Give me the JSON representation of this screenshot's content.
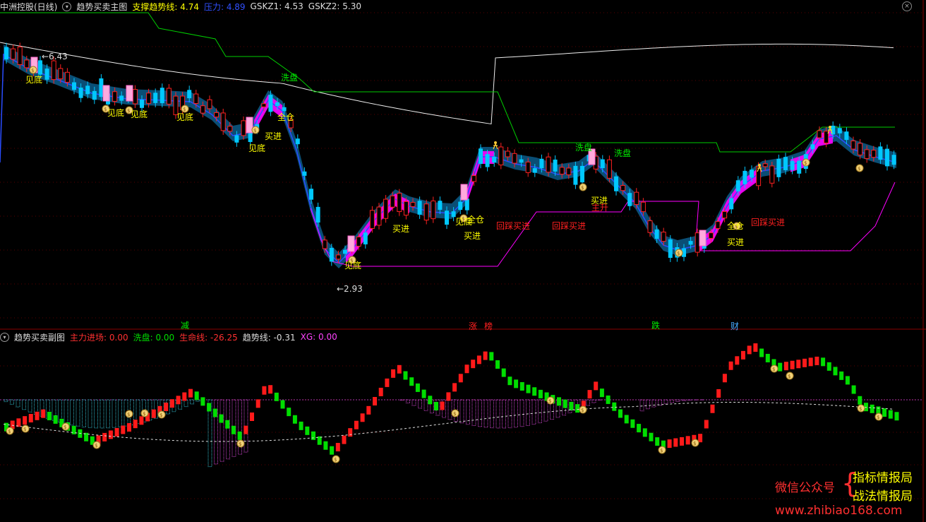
{
  "main_header": {
    "title": "中洲控股(日线)",
    "indicator": "趋势买卖主图",
    "support_label": "支撑趋势线: 4.74",
    "pressure_label": "压力: 4.89",
    "gskz1": "GSKZ1: 4.53",
    "gskz2": "GSKZ2: 5.30"
  },
  "sub_header": {
    "indicator": "趋势买卖副图",
    "zljc": "主力进场: 0.00",
    "xipan": "洗盘: 0.00",
    "shengming": "生命线: -26.25",
    "qushi": "趋势线: -0.31",
    "xg": "XG: 0.00"
  },
  "price_markers": {
    "high": "←6.43",
    "low": "←2.93"
  },
  "signals": {
    "jiandi": "见底",
    "maijin": "买进",
    "xipan": "洗盘",
    "quancang": "全仓",
    "huicai": "回踩买进",
    "zhusheng": "主升"
  },
  "bottom_tags": [
    "减",
    "涨",
    "榜",
    "跌",
    "财"
  ],
  "watermark": {
    "wechat": "微信公众号",
    "line1": "指标情报局",
    "line2": "战法情报局",
    "url": "www.zhibiao168.com"
  },
  "colors": {
    "up": "#ff2020",
    "down": "#00c8ff",
    "support": "#00cc00",
    "pressure": "#2a4dff",
    "yellow": "#ffff00",
    "magenta": "#ff00ff"
  },
  "icons": [
    "money-bag-icon",
    "runner-icon",
    "close-icon"
  ]
}
